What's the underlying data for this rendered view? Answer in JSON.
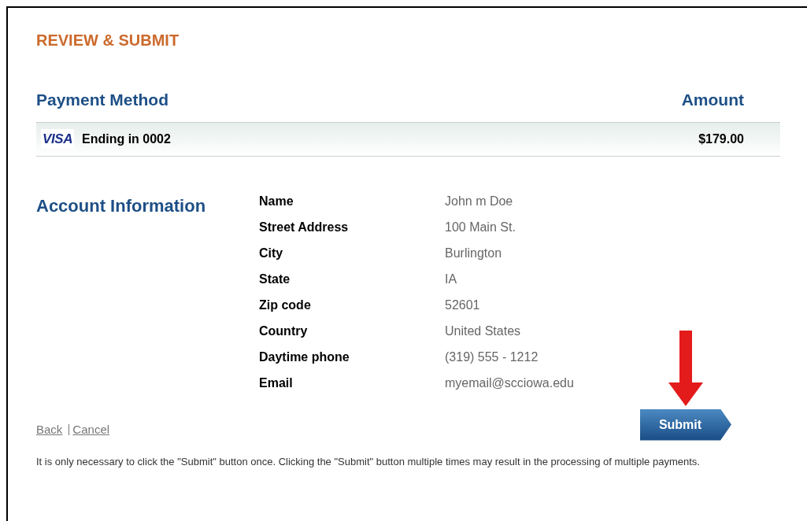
{
  "title": "REVIEW & SUBMIT",
  "payment": {
    "method_heading": "Payment Method",
    "amount_heading": "Amount",
    "card_brand": "VISA",
    "card_text": "Ending in 0002",
    "amount": "$179.00"
  },
  "account": {
    "heading": "Account Information",
    "fields": [
      {
        "label": "Name",
        "value": "John m Doe"
      },
      {
        "label": "Street Address",
        "value": "100 Main St."
      },
      {
        "label": "City",
        "value": "Burlington"
      },
      {
        "label": "State",
        "value": "IA"
      },
      {
        "label": "Zip code",
        "value": "52601"
      },
      {
        "label": "Country",
        "value": "United States"
      },
      {
        "label": "Daytime phone",
        "value": "(319) 555 - 1212"
      },
      {
        "label": "Email",
        "value": "myemail@scciowa.edu"
      }
    ]
  },
  "links": [
    {
      "label": "Back"
    },
    {
      "label": "Cancel"
    }
  ],
  "submit_button": "Submit",
  "note": "It is only necessary to click the \"Submit\" button once. Clicking the \"Submit\" button multiple times may result in the processing of multiple payments."
}
